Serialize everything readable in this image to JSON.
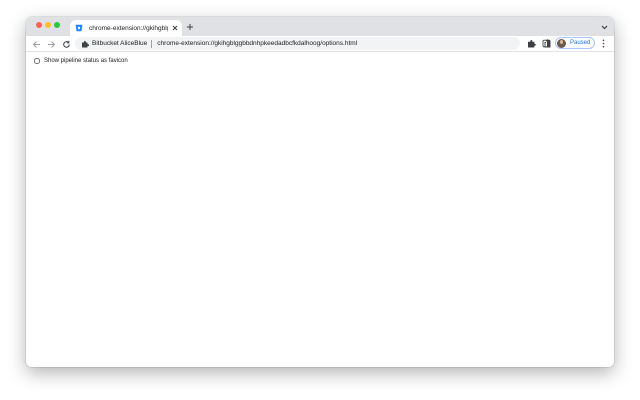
{
  "browser": {
    "tab": {
      "title": "chrome-extension://gkihgblggb",
      "favicon": "bitbucket-icon"
    },
    "omnibox": {
      "chip_label": "Bitbucket AliceBlue",
      "url": "chrome-extension://gkihgblggbbdnhpkeedadbcfkdalhoog/options.html"
    },
    "profile": {
      "status_label": "Paused"
    }
  },
  "options": {
    "show_pipeline_favicon": {
      "label": "Show pipeline status as favicon",
      "checked": false
    }
  },
  "colors": {
    "tabstrip": "#dfe1e5",
    "omnibox": "#f1f3f4",
    "accent": "#1a73e8",
    "bitbucket": "#2684ff"
  }
}
